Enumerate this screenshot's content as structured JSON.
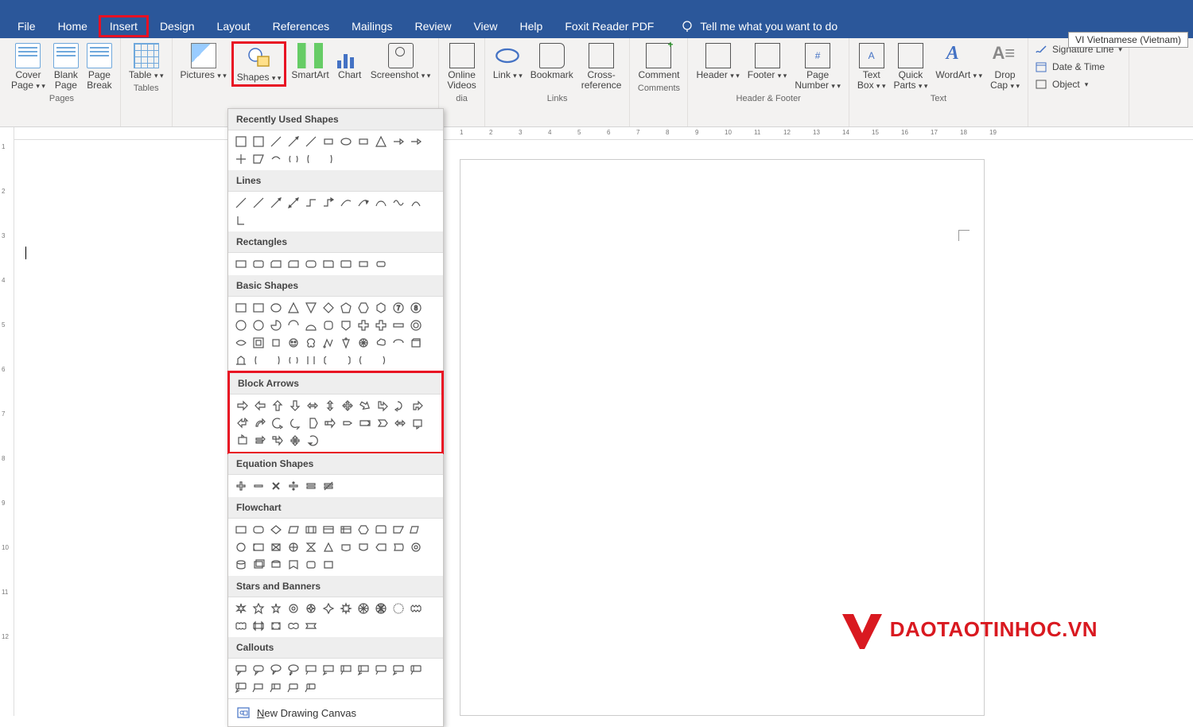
{
  "ime_label": "VI  Vietnamese (Vietnam)",
  "menu": {
    "file": "File",
    "home": "Home",
    "insert": "Insert",
    "design": "Design",
    "layout": "Layout",
    "references": "References",
    "mailings": "Mailings",
    "review": "Review",
    "view": "View",
    "help": "Help",
    "foxit": "Foxit Reader PDF",
    "tell_me": "Tell me what you want to do"
  },
  "ribbon": {
    "cover_page": "Cover\nPage",
    "blank_page": "Blank\nPage",
    "page_break": "Page\nBreak",
    "pages_group": "Pages",
    "table": "Table",
    "tables_group": "Tables",
    "pictures": "Pictures",
    "shapes": "Shapes",
    "smartart": "SmartArt",
    "chart": "Chart",
    "screenshot": "Screenshot",
    "online_videos": "Online\nVideos",
    "media_group": "dia",
    "link": "Link",
    "bookmark": "Bookmark",
    "cross_reference": "Cross-\nreference",
    "links_group": "Links",
    "comment": "Comment",
    "comments_group": "Comments",
    "header": "Header",
    "footer": "Footer",
    "page_number": "Page\nNumber",
    "hf_group": "Header & Footer",
    "text_box": "Text\nBox",
    "quick_parts": "Quick\nParts",
    "wordart": "WordArt",
    "drop_cap": "Drop\nCap",
    "signature": "Signature Line",
    "datetime": "Date & Time",
    "object": "Object",
    "text_group": "Text"
  },
  "shapes_menu": {
    "recently": "Recently Used Shapes",
    "lines": "Lines",
    "rectangles": "Rectangles",
    "basic": "Basic Shapes",
    "block_arrows": "Block Arrows",
    "equation": "Equation Shapes",
    "flowchart": "Flowchart",
    "stars": "Stars and Banners",
    "callouts": "Callouts",
    "new_canvas_n": "N",
    "new_canvas_rest": "ew Drawing Canvas",
    "counts": {
      "recently": 17,
      "lines": 12,
      "rectangles": 9,
      "basic": 42,
      "block_arrows": 27,
      "equation": 6,
      "flowchart": 28,
      "stars": 16,
      "callouts": 16
    }
  },
  "ruler_h": [
    "1",
    "2",
    "3",
    "4",
    "5",
    "6",
    "7",
    "8",
    "9",
    "10",
    "11",
    "12",
    "13",
    "14",
    "15",
    "16",
    "17",
    "18",
    "19"
  ],
  "ruler_v": [
    "1",
    "2",
    "3",
    "4",
    "5",
    "6",
    "7",
    "8",
    "9",
    "10",
    "11",
    "12"
  ],
  "watermark": {
    "text": "DAOTAOTINHOC.VN"
  }
}
